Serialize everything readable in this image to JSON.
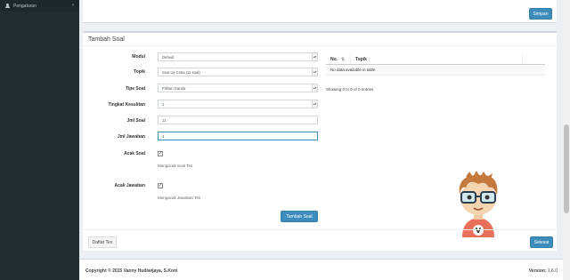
{
  "sidebar": {
    "menu_label": "Pengaturan",
    "menu_icon": "user-icon",
    "chevron": "‹"
  },
  "top_box": {
    "save_label": "Simpan"
  },
  "form": {
    "title": "Tambah Soal",
    "fields": {
      "modul": {
        "label": "Modul",
        "value": "Default"
      },
      "topik": {
        "label": "Topik",
        "value": "Soal Uji Coba (11 soal)"
      },
      "tipe_soal": {
        "label": "Tipe Soal",
        "value": "Pilihan Ganda"
      },
      "tingkat": {
        "label": "Tingkat Kesulitan",
        "value": "1"
      },
      "jml_soal": {
        "label": "Jml Soal",
        "value": "11"
      },
      "jml_jawaban": {
        "label": "Jml Jawaban",
        "value": "4"
      },
      "acak_soal": {
        "label": "Acak Soal",
        "checked": true,
        "help": "Mengacak Soal Tes"
      },
      "acak_jawaban": {
        "label": "Acak Jawaban",
        "checked": true,
        "help": "Mengacak Jawaban Tes"
      }
    },
    "submit_label": "Tambah Soal",
    "check_glyph": "✓",
    "arrow_glyph": "▴▾"
  },
  "table": {
    "columns": [
      "No.",
      "Topik"
    ],
    "sort_glyph": "⇅",
    "empty_text": "No data available in table",
    "info": "Showing 0 to 0 of 0 entries"
  },
  "footer_buttons": {
    "back_label": "Daftar Tes",
    "done_label": "Selesai"
  },
  "page_footer": {
    "copyright": "Copyright © 2015 Vanny Hudiwijaya, S.Kom",
    "version_label": "Version:",
    "version_value": "1.6.0"
  },
  "colors": {
    "sidebar": "#222d32",
    "primary": "#3c8dbc",
    "body_bg": "#ecf0f5"
  }
}
